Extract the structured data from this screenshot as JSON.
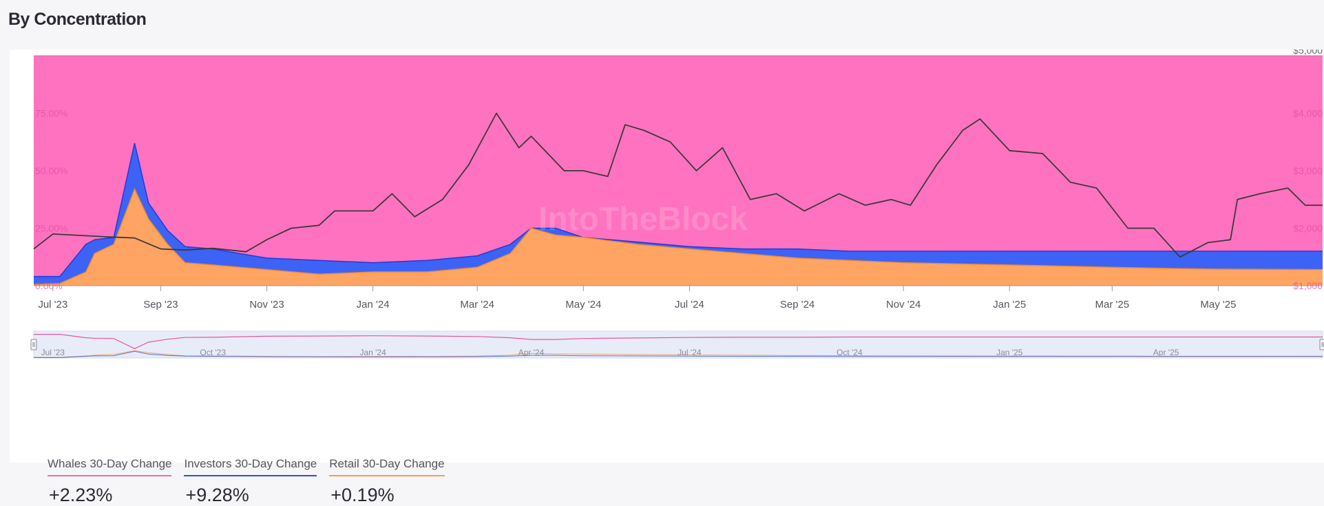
{
  "page": {
    "title": "By Concentration"
  },
  "watermark": "IntoTheBlock",
  "colors": {
    "whales": "#ff72bf",
    "investors": "#3c63f5",
    "retail": "#ffa463",
    "price": "#3a3a3a",
    "whales_line": "#e8559f",
    "investors_line": "#1f3bd8",
    "retail_line": "#f5892c"
  },
  "legend": [
    {
      "label": "Whales 30-Day Change",
      "value": "+2.23%",
      "color": "#f06aae"
    },
    {
      "label": "Investors 30-Day Change",
      "value": "+9.28%",
      "color": "#2d4ae6"
    },
    {
      "label": "Retail 30-Day Change",
      "value": "+0.19%",
      "color": "#f79a52"
    }
  ],
  "chart_data": {
    "type": "area",
    "stacking": "percent",
    "x_axis": {
      "start": "2023-06-20",
      "end": "2025-06-30",
      "tick_labels": [
        "Jul '23",
        "Sep '23",
        "Nov '23",
        "Jan '24",
        "Mar '24",
        "May '24",
        "Jul '24",
        "Sep '24",
        "Nov '24",
        "Jan '25",
        "Mar '25",
        "May '25"
      ],
      "tick_dates": [
        "2023-07-01",
        "2023-09-01",
        "2023-11-01",
        "2024-01-01",
        "2024-03-01",
        "2024-05-01",
        "2024-07-01",
        "2024-09-01",
        "2024-11-01",
        "2025-01-01",
        "2025-03-01",
        "2025-05-01"
      ]
    },
    "y_left": {
      "ylim": [
        0,
        100
      ],
      "tick_labels": [
        "0.00%",
        "25.00%",
        "50.00%",
        "75.00%"
      ],
      "tick_values": [
        0,
        25,
        50,
        75
      ]
    },
    "y_right": {
      "ylim": [
        1000,
        5000
      ],
      "tick_labels": [
        "$1,000",
        "$2,000",
        "$3,000",
        "$4,000",
        "$5,000"
      ],
      "tick_values": [
        1000,
        2000,
        3000,
        4000,
        5000
      ]
    },
    "grid": false,
    "series": [
      {
        "name": "Retail",
        "axis": "left",
        "stack_order": 1,
        "points": [
          [
            "2023-06-20",
            0.5
          ],
          [
            "2023-07-05",
            1
          ],
          [
            "2023-07-20",
            6
          ],
          [
            "2023-07-25",
            14
          ],
          [
            "2023-08-05",
            18
          ],
          [
            "2023-08-17",
            42
          ],
          [
            "2023-08-25",
            29
          ],
          [
            "2023-09-05",
            18
          ],
          [
            "2023-09-15",
            10
          ],
          [
            "2023-10-01",
            9
          ],
          [
            "2023-11-01",
            7
          ],
          [
            "2023-12-01",
            5
          ],
          [
            "2024-01-01",
            6
          ],
          [
            "2024-02-01",
            6
          ],
          [
            "2024-03-01",
            8
          ],
          [
            "2024-03-20",
            14
          ],
          [
            "2024-04-01",
            25
          ],
          [
            "2024-04-15",
            22
          ],
          [
            "2024-05-01",
            21
          ],
          [
            "2024-06-01",
            18
          ],
          [
            "2024-07-01",
            16
          ],
          [
            "2024-08-01",
            14
          ],
          [
            "2024-09-01",
            12
          ],
          [
            "2024-10-01",
            11
          ],
          [
            "2024-11-01",
            10
          ],
          [
            "2024-12-01",
            9.5
          ],
          [
            "2025-01-01",
            9
          ],
          [
            "2025-02-01",
            8.5
          ],
          [
            "2025-03-01",
            8
          ],
          [
            "2025-04-01",
            7.5
          ],
          [
            "2025-05-01",
            7.2
          ],
          [
            "2025-06-30",
            7
          ]
        ]
      },
      {
        "name": "Investors",
        "axis": "left",
        "stack_order": 2,
        "points": [
          [
            "2023-06-20",
            4
          ],
          [
            "2023-07-05",
            4
          ],
          [
            "2023-07-20",
            18
          ],
          [
            "2023-07-25",
            20
          ],
          [
            "2023-08-05",
            21
          ],
          [
            "2023-08-17",
            62
          ],
          [
            "2023-08-25",
            36
          ],
          [
            "2023-09-05",
            24
          ],
          [
            "2023-09-15",
            17
          ],
          [
            "2023-10-01",
            16
          ],
          [
            "2023-11-01",
            12
          ],
          [
            "2023-12-01",
            11
          ],
          [
            "2024-01-01",
            10
          ],
          [
            "2024-02-01",
            11
          ],
          [
            "2024-03-01",
            13
          ],
          [
            "2024-03-20",
            18
          ],
          [
            "2024-04-01",
            25
          ],
          [
            "2024-04-15",
            25
          ],
          [
            "2024-05-01",
            21
          ],
          [
            "2024-06-01",
            19
          ],
          [
            "2024-07-01",
            17
          ],
          [
            "2024-08-01",
            16
          ],
          [
            "2024-09-01",
            16
          ],
          [
            "2024-10-01",
            15
          ],
          [
            "2024-11-01",
            15
          ],
          [
            "2024-12-01",
            15
          ],
          [
            "2025-01-01",
            15
          ],
          [
            "2025-02-01",
            15
          ],
          [
            "2025-03-01",
            15
          ],
          [
            "2025-04-01",
            15
          ],
          [
            "2025-05-01",
            15
          ],
          [
            "2025-06-30",
            15
          ]
        ]
      },
      {
        "name": "Whales",
        "axis": "left",
        "stack_order": 3,
        "fills_remaining_to_100": true,
        "points": [
          [
            "2023-06-20",
            96
          ],
          [
            "2023-08-17",
            38
          ],
          [
            "2023-09-15",
            83
          ],
          [
            "2024-04-01",
            75
          ],
          [
            "2025-06-30",
            85
          ]
        ]
      },
      {
        "name": "Price",
        "axis": "right",
        "type": "line",
        "points": [
          [
            "2023-06-20",
            1640
          ],
          [
            "2023-07-01",
            1900
          ],
          [
            "2023-07-20",
            1870
          ],
          [
            "2023-08-01",
            1850
          ],
          [
            "2023-08-17",
            1830
          ],
          [
            "2023-09-01",
            1640
          ],
          [
            "2023-09-15",
            1620
          ],
          [
            "2023-10-01",
            1650
          ],
          [
            "2023-10-20",
            1590
          ],
          [
            "2023-11-01",
            1800
          ],
          [
            "2023-11-15",
            2000
          ],
          [
            "2023-12-01",
            2050
          ],
          [
            "2023-12-10",
            2300
          ],
          [
            "2024-01-01",
            2300
          ],
          [
            "2024-01-12",
            2600
          ],
          [
            "2024-01-25",
            2200
          ],
          [
            "2024-02-10",
            2500
          ],
          [
            "2024-02-25",
            3100
          ],
          [
            "2024-03-12",
            4000
          ],
          [
            "2024-03-25",
            3400
          ],
          [
            "2024-04-01",
            3600
          ],
          [
            "2024-04-20",
            3000
          ],
          [
            "2024-05-01",
            3000
          ],
          [
            "2024-05-15",
            2900
          ],
          [
            "2024-05-25",
            3800
          ],
          [
            "2024-06-05",
            3700
          ],
          [
            "2024-06-20",
            3500
          ],
          [
            "2024-07-05",
            3000
          ],
          [
            "2024-07-20",
            3400
          ],
          [
            "2024-08-05",
            2500
          ],
          [
            "2024-08-20",
            2600
          ],
          [
            "2024-09-05",
            2300
          ],
          [
            "2024-09-25",
            2600
          ],
          [
            "2024-10-10",
            2400
          ],
          [
            "2024-10-25",
            2500
          ],
          [
            "2024-11-05",
            2400
          ],
          [
            "2024-11-20",
            3100
          ],
          [
            "2024-12-05",
            3700
          ],
          [
            "2024-12-15",
            3900
          ],
          [
            "2025-01-01",
            3350
          ],
          [
            "2025-01-20",
            3300
          ],
          [
            "2025-02-05",
            2800
          ],
          [
            "2025-02-20",
            2700
          ],
          [
            "2025-03-10",
            2000
          ],
          [
            "2025-03-25",
            2000
          ],
          [
            "2025-04-09",
            1500
          ],
          [
            "2025-04-25",
            1750
          ],
          [
            "2025-05-08",
            1800
          ],
          [
            "2025-05-12",
            2500
          ],
          [
            "2025-05-25",
            2600
          ],
          [
            "2025-06-10",
            2700
          ],
          [
            "2025-06-20",
            2400
          ],
          [
            "2025-06-30",
            2400
          ]
        ]
      }
    ],
    "navigator": {
      "tick_labels": [
        "Jul '23",
        "Oct '23",
        "Jan '24",
        "Apr '24",
        "Jul '24",
        "Oct '24",
        "Jan '25",
        "Apr '25"
      ],
      "tick_dates": [
        "2023-07-01",
        "2023-10-01",
        "2024-01-01",
        "2024-04-01",
        "2024-07-01",
        "2024-10-01",
        "2025-01-01",
        "2025-04-01"
      ]
    }
  }
}
